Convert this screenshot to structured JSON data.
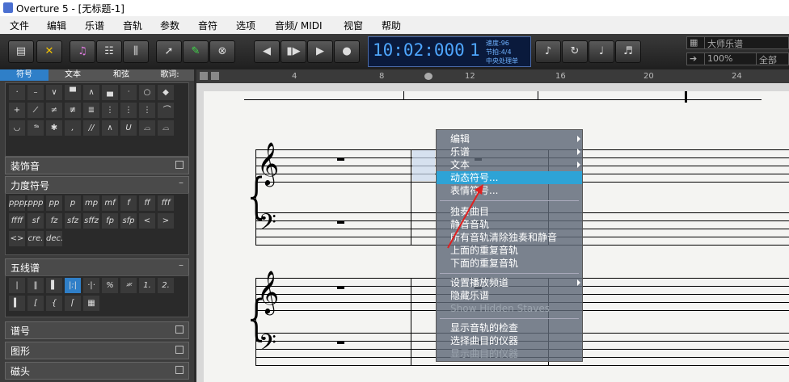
{
  "window": {
    "title": "Overture 5 - [无标题-1]"
  },
  "menubar": {
    "items": [
      "文件",
      "编辑",
      "乐谱",
      "音轨",
      "参数",
      "音符",
      "选项",
      "音频/ MIDI",
      "视窗",
      "帮助"
    ]
  },
  "transport": {
    "time": "10:02:000",
    "measure": "1",
    "tempo": "速度:96",
    "meter": "节拍:4/4",
    "cpu": "中央处理单"
  },
  "right": {
    "view_select": "大师乐谱",
    "zoom": "100%",
    "scope": "全部"
  },
  "sidebar": {
    "tabs": [
      "符号",
      "文本",
      "和弦",
      "歌词:"
    ],
    "section_ornaments": "装饰音",
    "section_dynamics": "力度符号",
    "dynamics": [
      "pppp",
      "ppp",
      "pp",
      "p",
      "mp",
      "mf",
      "f",
      "ff",
      "fff",
      "ffff",
      "sf",
      "fz",
      "sfz",
      "sffz",
      "fp",
      "sfp",
      "<",
      ">",
      "<>",
      "cre.",
      "dec."
    ],
    "section_staff": "五线谱",
    "section_clef": "谱号",
    "section_graphics": "图形",
    "section_tape": "磁头"
  },
  "ruler": {
    "marks": [
      "4",
      "8",
      "12",
      "16",
      "20",
      "24"
    ]
  },
  "context_menu": {
    "items": [
      {
        "label": "编辑",
        "submenu": true
      },
      {
        "label": "乐谱",
        "submenu": true
      },
      {
        "label": "文本",
        "submenu": true
      },
      {
        "label": "动态符号...",
        "highlight": true
      },
      {
        "label": "表情符号..."
      },
      {
        "label": "独奏曲目"
      },
      {
        "label": "静音音轨"
      },
      {
        "label": "所有音轨清除独奏和静音"
      },
      {
        "label": "上面的重复音轨"
      },
      {
        "label": "下面的重复音轨"
      },
      {
        "label": "设置播放频道",
        "submenu": true
      },
      {
        "label": "隐藏乐谱"
      },
      {
        "label": "Show Hidden Staves",
        "disabled": true
      },
      {
        "label": "显示音轨的检查"
      },
      {
        "label": "选择曲目的仪器"
      },
      {
        "label": "显示曲目的仪器",
        "disabled": true
      }
    ]
  }
}
